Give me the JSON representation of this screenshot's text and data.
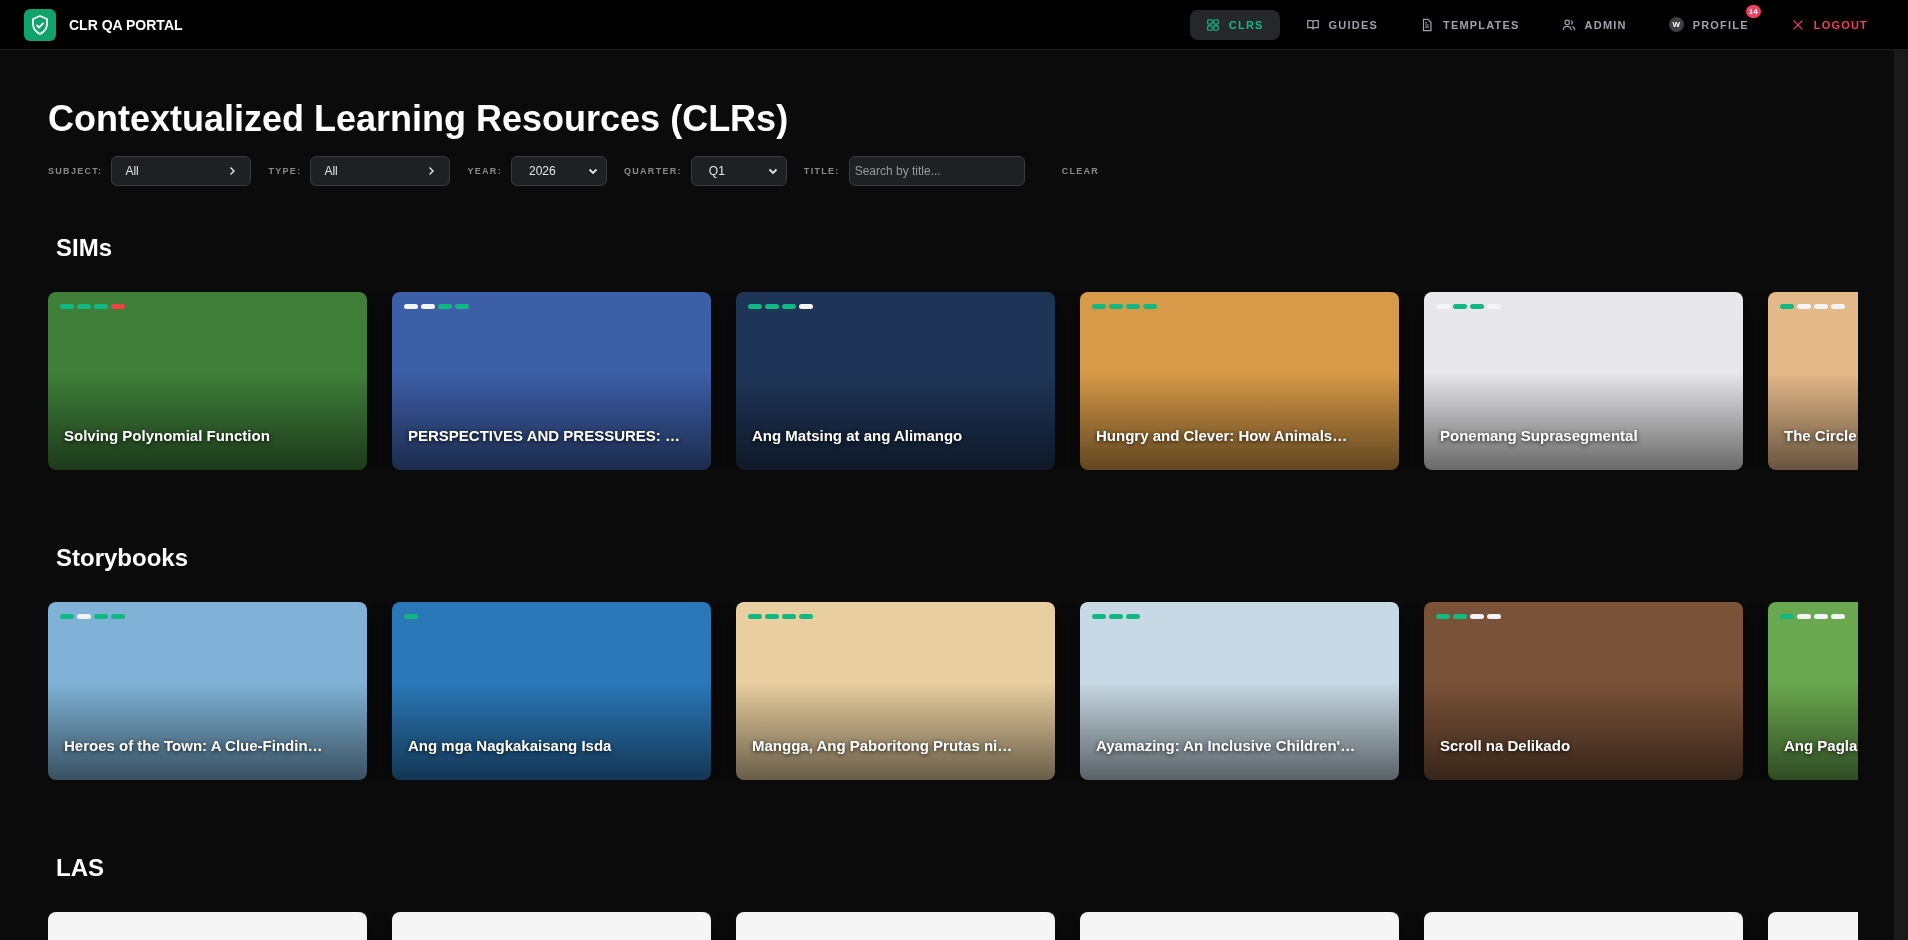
{
  "header": {
    "brand": "CLR QA PORTAL",
    "nav": [
      {
        "kind": "grid",
        "label": "CLRS",
        "selected": true
      },
      {
        "kind": "book",
        "label": "GUIDES",
        "selected": false
      },
      {
        "kind": "doc",
        "label": "TEMPLATES",
        "selected": false
      },
      {
        "kind": "users",
        "label": "ADMIN",
        "selected": false
      },
      {
        "kind": "avatar",
        "label": "PROFILE",
        "selected": false,
        "avatar": "W",
        "badge": "14"
      },
      {
        "kind": "logout",
        "label": "LOGOUT",
        "selected": false
      }
    ]
  },
  "page_title": "Contextualized Learning Resources (CLRs)",
  "filters": [
    {
      "kind": "picker",
      "label": "SUBJECT:",
      "value": "All"
    },
    {
      "kind": "picker",
      "label": "TYPE:",
      "value": "All"
    },
    {
      "kind": "select",
      "label": "YEAR:",
      "value": "2026"
    },
    {
      "kind": "select",
      "label": "QUARTER:",
      "value": "Q1"
    },
    {
      "kind": "search",
      "label": "TITLE:",
      "placeholder": "Search by title..."
    }
  ],
  "clear_button": "CLEAR",
  "sections": [
    {
      "title": "SIMs",
      "cards": [
        {
          "title": "Solving Polynomial Function",
          "steps": [
            {
              "kind": "done"
            },
            {
              "kind": "done"
            },
            {
              "kind": "done"
            },
            {
              "kind": "flagged"
            }
          ]
        },
        {
          "title": "PERSPECTIVES AND PRESSURES: …",
          "steps": [
            {
              "kind": "pending"
            },
            {
              "kind": "pending"
            },
            {
              "kind": "done"
            },
            {
              "kind": "done"
            }
          ]
        },
        {
          "title": "Ang Matsing at ang Alimango",
          "steps": [
            {
              "kind": "done"
            },
            {
              "kind": "done"
            },
            {
              "kind": "done"
            },
            {
              "kind": "pending"
            }
          ]
        },
        {
          "title": "Hungry and Clever: How Animals…",
          "steps": [
            {
              "kind": "done"
            },
            {
              "kind": "done"
            },
            {
              "kind": "done"
            },
            {
              "kind": "done"
            }
          ]
        },
        {
          "title": "Ponemang Suprasegmental",
          "steps": [
            {
              "kind": "pending"
            },
            {
              "kind": "done"
            },
            {
              "kind": "done"
            },
            {
              "kind": "pending"
            }
          ]
        },
        {
          "title": "The Circle",
          "steps": [
            {
              "kind": "done"
            },
            {
              "kind": "pending"
            },
            {
              "kind": "pending"
            },
            {
              "kind": "pending"
            }
          ]
        }
      ]
    },
    {
      "title": "Storybooks",
      "cards": [
        {
          "title": "Heroes of the Town: A Clue-Findin…",
          "steps": [
            {
              "kind": "done"
            },
            {
              "kind": "pending"
            },
            {
              "kind": "done"
            },
            {
              "kind": "done"
            }
          ]
        },
        {
          "title": "Ang mga Nagkakaisang Isda",
          "steps": [
            {
              "kind": "done"
            }
          ]
        },
        {
          "title": "Mangga, Ang Paboritong Prutas ni…",
          "steps": [
            {
              "kind": "done"
            },
            {
              "kind": "done"
            },
            {
              "kind": "done"
            },
            {
              "kind": "done"
            }
          ]
        },
        {
          "title": "Ayamazing: An Inclusive Children'…",
          "steps": [
            {
              "kind": "done"
            },
            {
              "kind": "done"
            },
            {
              "kind": "done"
            }
          ]
        },
        {
          "title": "Scroll na Delikado",
          "steps": [
            {
              "kind": "done"
            },
            {
              "kind": "done"
            },
            {
              "kind": "pending"
            },
            {
              "kind": "pending"
            }
          ]
        },
        {
          "title": "Ang Pagla",
          "steps": [
            {
              "kind": "done"
            },
            {
              "kind": "pending"
            },
            {
              "kind": "pending"
            },
            {
              "kind": "pending"
            }
          ]
        }
      ]
    },
    {
      "title": "LAS"
    }
  ]
}
